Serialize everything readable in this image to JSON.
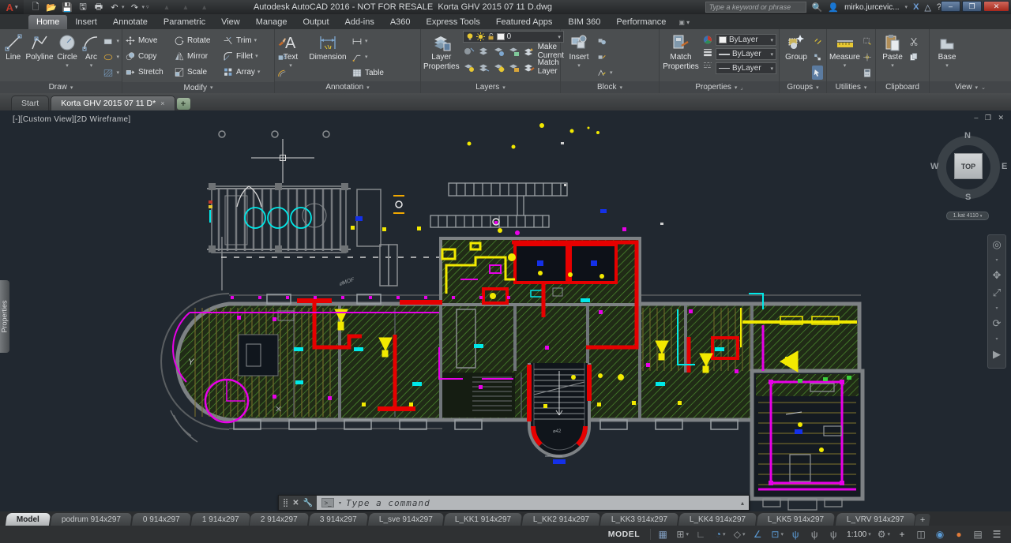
{
  "ui": {
    "chevron": "▾",
    "close_x": "×",
    "up_arrow": "▴",
    "min": "‒",
    "restore": "❐",
    "close": "✕",
    "plus": "+",
    "vp_buttons": "‒ ❐ ✕"
  },
  "title_bar": {
    "app_title": "Autodesk AutoCAD 2016 - NOT FOR RESALE",
    "doc_title": "Korta GHV 2015 07 11 D.dwg",
    "search_placeholder": "Type a keyword or phrase",
    "user": "mirko.jurcevic...",
    "logo_letter": "A",
    "qat": [
      {
        "name": "new-file-icon",
        "glyph": "🗋"
      },
      {
        "name": "open-folder-icon",
        "glyph": "📂"
      },
      {
        "name": "save-icon",
        "glyph": "💾"
      },
      {
        "name": "saveas-icon",
        "glyph": "🖫"
      },
      {
        "name": "plot-icon",
        "glyph": "🖶"
      },
      {
        "name": "undo-icon",
        "glyph": "↶"
      },
      {
        "name": "redo-icon",
        "glyph": "↷"
      }
    ]
  },
  "ribbon": {
    "active_tab": "Home",
    "tabs": [
      "Home",
      "Insert",
      "Annotate",
      "Parametric",
      "View",
      "Manage",
      "Output",
      "Add-ins",
      "A360",
      "Express Tools",
      "Featured Apps",
      "BIM 360",
      "Performance"
    ],
    "draw": {
      "label": "Draw",
      "line": "Line",
      "polyline": "Polyline",
      "circle": "Circle",
      "arc": "Arc"
    },
    "modify": {
      "label": "Modify",
      "move": "Move",
      "rotate": "Rotate",
      "trim": "Trim",
      "copy": "Copy",
      "mirror": "Mirror",
      "fillet": "Fillet",
      "stretch": "Stretch",
      "scale": "Scale",
      "array": "Array"
    },
    "annotation": {
      "label": "Annotation",
      "text": "Text",
      "dimension": "Dimension",
      "table": "Table"
    },
    "layers": {
      "label": "Layers",
      "layer_properties_1": "Layer",
      "layer_properties_2": "Properties",
      "current_layer": "0",
      "make_current": "Make Current",
      "match_layer": "Match Layer"
    },
    "block": {
      "label": "Block",
      "insert": "Insert"
    },
    "properties": {
      "label": "Properties",
      "match_1": "Match",
      "match_2": "Properties",
      "color": "ByLayer",
      "lineweight": "ByLayer",
      "linetype": "ByLayer"
    },
    "groups": {
      "label": "Groups",
      "group": "Group"
    },
    "utilities": {
      "label": "Utilities",
      "measure": "Measure"
    },
    "clipboard": {
      "label": "Clipboard",
      "paste": "Paste"
    },
    "view": {
      "label": "View",
      "base": "Base"
    }
  },
  "file_tabs": {
    "start": "Start",
    "doc": "Korta GHV 2015 07 11 D*"
  },
  "viewport": {
    "label": "[-][Custom View][2D Wireframe]",
    "properties_tab": "Properties",
    "level_pill": "1.kat 4110",
    "viewcube": {
      "top": "TOP",
      "n": "N",
      "s": "S",
      "e": "E",
      "w": "W"
    }
  },
  "command_line": {
    "placeholder": "Type a command",
    "prompt": ">_"
  },
  "layout_tabs": {
    "active": "Model",
    "items": [
      "Model",
      "podrum 914x297",
      "0 914x297",
      "1 914x297",
      "2 914x297",
      "3 914x297",
      "L_sve 914x297",
      "L_KK1 914x297",
      "L_KK2 914x297",
      "L_KK3 914x297",
      "L_KK4 914x297",
      "L_KK5 914x297",
      "L_VRV 914x297"
    ]
  },
  "status_bar": {
    "model_label": "MODEL",
    "scale": "1:100",
    "icons": [
      {
        "name": "grid-icon",
        "glyph": "▦",
        "style": "color:#7f9cbe",
        "chev": ""
      },
      {
        "name": "snap-icon",
        "glyph": "⊞",
        "style": "color:#9fa3a6",
        "chev": "▾"
      },
      {
        "name": "ortho-icon",
        "glyph": "∟",
        "style": "color:#9fa3a6",
        "chev": ""
      },
      {
        "name": "polar-tracking-icon",
        "glyph": "◔",
        "style": "color:#5b9bd5",
        "chev": "▾"
      },
      {
        "name": "isodraft-icon",
        "glyph": "◇",
        "style": "color:#9fa3a6",
        "chev": "▾"
      },
      {
        "name": "object-snap-tracking-icon",
        "glyph": "∠",
        "style": "color:#5b9bd5",
        "chev": ""
      },
      {
        "name": "object-snap-icon",
        "glyph": "⊡",
        "style": "color:#5b9bd5",
        "chev": "▾"
      },
      {
        "name": "annotation-visibility-icon",
        "glyph": "ψ",
        "style": "color:#5b9bd5",
        "chev": ""
      },
      {
        "name": "annotation-autoscale-icon",
        "glyph": "ψ",
        "style": "color:#9fa3a6",
        "chev": ""
      },
      {
        "name": "annotation-scale-icon",
        "glyph": "ψ",
        "style": "color:#9fa3a6",
        "chev": ""
      }
    ],
    "icons_right": [
      {
        "name": "workspace-gear-icon",
        "glyph": "⚙",
        "style": "color:#9fa3a6",
        "chev": "▾"
      },
      {
        "name": "annotation-monitor-plus-icon",
        "glyph": "+",
        "style": "color:#c8cbcd",
        "chev": ""
      },
      {
        "name": "units-interface-icon",
        "glyph": "◫",
        "style": "color:#9fa3a6",
        "chev": ""
      },
      {
        "name": "graphics-performance-icon",
        "glyph": "◉",
        "style": "color:#5b9bd5",
        "chev": ""
      },
      {
        "name": "isolate-objects-icon",
        "glyph": "●",
        "style": "color:#e07b39",
        "chev": ""
      },
      {
        "name": "clean-screen-icon",
        "glyph": "▤",
        "style": "color:#9fa3a6",
        "chev": ""
      },
      {
        "name": "customize-menu-icon",
        "glyph": "☰",
        "style": "color:#c8cbcd",
        "chev": ""
      }
    ]
  }
}
